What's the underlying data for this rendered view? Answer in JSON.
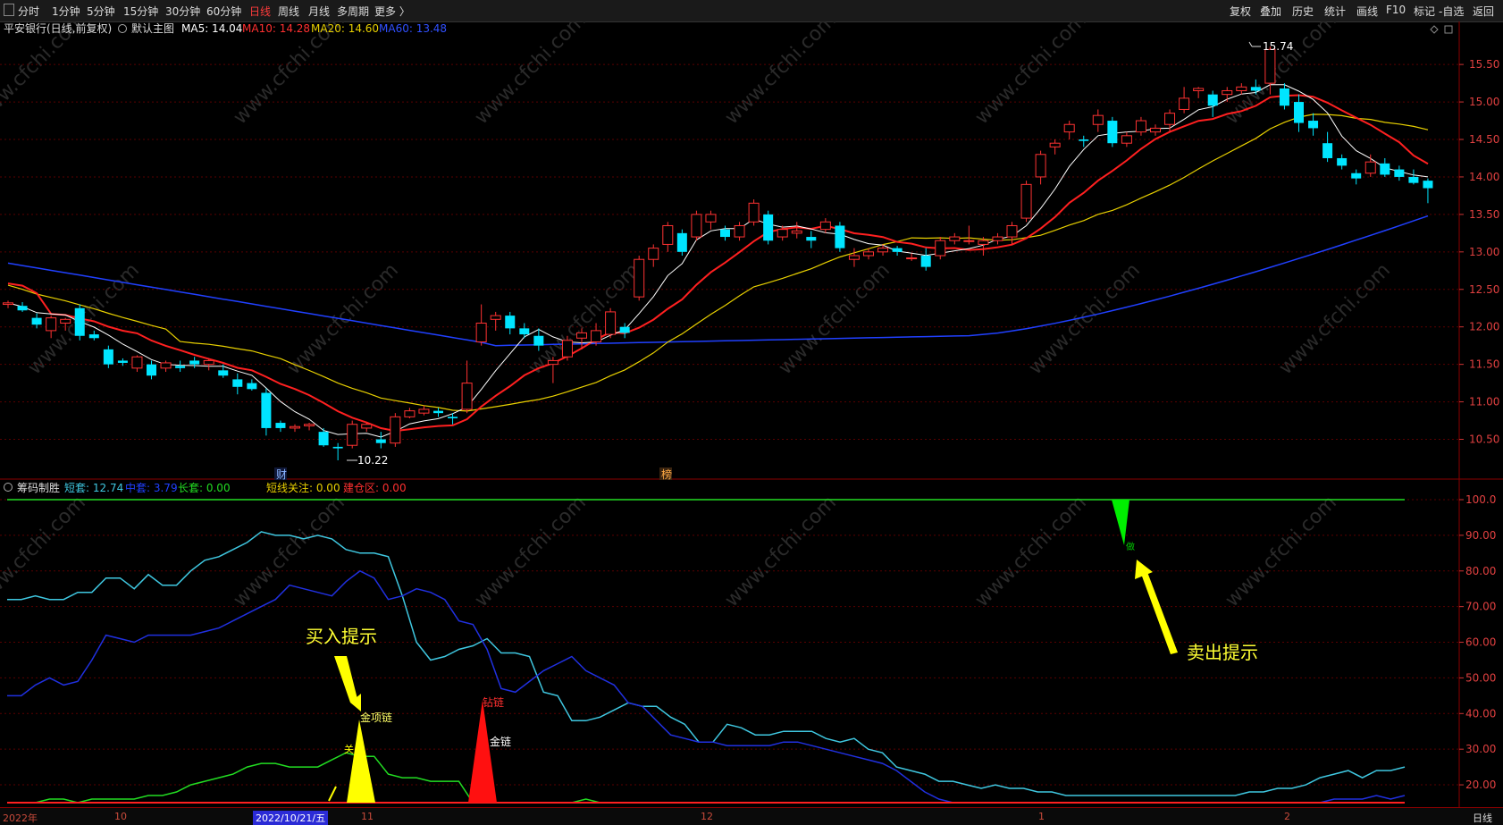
{
  "toolbar": {
    "left": [
      {
        "label": "分时"
      },
      {
        "label": "1分钟"
      },
      {
        "label": "5分钟"
      },
      {
        "label": "15分钟"
      },
      {
        "label": "30分钟"
      },
      {
        "label": "60分钟"
      },
      {
        "label": "日线",
        "active": true
      },
      {
        "label": "周线"
      },
      {
        "label": "月线"
      },
      {
        "label": "多周期"
      },
      {
        "label": "更多 〉"
      }
    ],
    "right": [
      {
        "label": "复权"
      },
      {
        "label": "叠加"
      },
      {
        "label": "历史"
      },
      {
        "label": "统计"
      },
      {
        "label": "画线"
      },
      {
        "label": "F10"
      },
      {
        "label": "标记"
      },
      {
        "label": "-自选"
      },
      {
        "label": "返回"
      }
    ]
  },
  "main_header": {
    "stock": "平安银行(日线,前复权)",
    "indicator": "默认主图",
    "ma5": "MA5: 14.04",
    "ma10": "MA10: 14.28",
    "ma20": "MA20: 14.60",
    "ma60": "MA60: 13.48"
  },
  "sub_header": {
    "name": "筹码制胜",
    "short": "短套: 12.74",
    "mid": "中套: 3.79",
    "long": "长套: 0.00",
    "focus": "短线关注: 0.00",
    "build": "建仓区: 0.00"
  },
  "price_axis": [
    "15.50",
    "15.00",
    "14.50",
    "14.00",
    "13.50",
    "13.00",
    "12.50",
    "12.00",
    "11.50",
    "11.00",
    "10.50"
  ],
  "sub_axis": [
    "100.0",
    "90.00",
    "80.00",
    "70.00",
    "60.00",
    "50.00",
    "40.00",
    "30.00",
    "20.00"
  ],
  "annotations": {
    "high": "15.74",
    "low": "10.22",
    "cai": "财",
    "bang": "榜",
    "buy_hint": "买入提示",
    "sell_hint": "卖出提示",
    "jinxianglian": "金项链",
    "zuanlian": "钻链",
    "jinlian": "金链",
    "guan": "关",
    "zuo": "做"
  },
  "date_axis": [
    {
      "label": "2022年"
    },
    {
      "label": "10"
    },
    {
      "label": "2022/10/21/五",
      "highlight": true
    },
    {
      "label": "11"
    },
    {
      "label": "12"
    },
    {
      "label": "1"
    },
    {
      "label": "2"
    }
  ],
  "period_label": "日线",
  "watermark": "www.cfchi.com",
  "colors": {
    "up": "#ff3232",
    "down": "#00e5ff",
    "ma5": "#ffffff",
    "ma10": "#ff2020",
    "ma20": "#e8d000",
    "ma60": "#2040ff",
    "short": "#3fc7e0",
    "mid": "#2030e0",
    "long": "#22dd22",
    "buy": "#ffff00",
    "sell": "#00ee00"
  },
  "chart_data": {
    "type": "candlestick",
    "candles": [
      [
        12.3,
        12.35,
        12.25,
        12.32
      ],
      [
        12.28,
        12.33,
        12.2,
        12.22
      ],
      [
        12.12,
        12.18,
        11.98,
        12.03
      ],
      [
        11.95,
        12.15,
        11.85,
        12.12
      ],
      [
        12.05,
        12.12,
        11.95,
        12.1
      ],
      [
        12.25,
        12.3,
        11.82,
        11.88
      ],
      [
        11.9,
        11.95,
        11.82,
        11.85
      ],
      [
        11.7,
        11.75,
        11.45,
        11.5
      ],
      [
        11.55,
        11.58,
        11.48,
        11.52
      ],
      [
        11.45,
        11.62,
        11.4,
        11.6
      ],
      [
        11.5,
        11.55,
        11.3,
        11.35
      ],
      [
        11.45,
        11.55,
        11.4,
        11.52
      ],
      [
        11.48,
        11.55,
        11.4,
        11.45
      ],
      [
        11.55,
        11.6,
        11.45,
        11.5
      ],
      [
        11.5,
        11.58,
        11.42,
        11.55
      ],
      [
        11.42,
        11.5,
        11.32,
        11.35
      ],
      [
        11.3,
        11.38,
        11.1,
        11.2
      ],
      [
        11.25,
        11.3,
        11.15,
        11.17
      ],
      [
        11.12,
        11.18,
        10.55,
        10.65
      ],
      [
        10.72,
        10.75,
        10.6,
        10.65
      ],
      [
        10.65,
        10.7,
        10.6,
        10.67
      ],
      [
        10.68,
        10.72,
        10.62,
        10.7
      ],
      [
        10.6,
        10.65,
        10.4,
        10.42
      ],
      [
        10.4,
        10.45,
        10.22,
        10.38
      ],
      [
        10.42,
        10.75,
        10.38,
        10.7
      ],
      [
        10.65,
        10.72,
        10.6,
        10.7
      ],
      [
        10.5,
        10.6,
        10.38,
        10.45
      ],
      [
        10.45,
        10.85,
        10.4,
        10.8
      ],
      [
        10.8,
        10.92,
        10.78,
        10.88
      ],
      [
        10.85,
        10.95,
        10.82,
        10.9
      ],
      [
        10.88,
        10.92,
        10.8,
        10.85
      ],
      [
        10.8,
        10.85,
        10.7,
        10.78
      ],
      [
        10.9,
        11.55,
        10.85,
        11.25
      ],
      [
        11.8,
        12.3,
        11.75,
        12.05
      ],
      [
        12.1,
        12.2,
        11.95,
        12.15
      ],
      [
        12.15,
        12.2,
        11.9,
        11.98
      ],
      [
        11.98,
        12.05,
        11.85,
        11.9
      ],
      [
        11.88,
        11.98,
        11.68,
        11.75
      ],
      [
        11.5,
        11.6,
        11.25,
        11.55
      ],
      [
        11.6,
        11.88,
        11.55,
        11.82
      ],
      [
        11.85,
        11.98,
        11.7,
        11.92
      ],
      [
        11.8,
        12.05,
        11.75,
        11.95
      ],
      [
        11.9,
        12.25,
        11.85,
        12.2
      ],
      [
        12.0,
        12.05,
        11.85,
        11.92
      ],
      [
        12.4,
        12.95,
        12.35,
        12.9
      ],
      [
        12.9,
        13.1,
        12.8,
        13.05
      ],
      [
        13.1,
        13.4,
        13.0,
        13.35
      ],
      [
        13.25,
        13.3,
        12.95,
        13.0
      ],
      [
        13.2,
        13.55,
        13.15,
        13.5
      ],
      [
        13.4,
        13.55,
        13.3,
        13.5
      ],
      [
        13.3,
        13.35,
        13.15,
        13.2
      ],
      [
        13.2,
        13.4,
        13.15,
        13.35
      ],
      [
        13.4,
        13.7,
        13.35,
        13.65
      ],
      [
        13.5,
        13.55,
        13.1,
        13.15
      ],
      [
        13.2,
        13.35,
        13.15,
        13.3
      ],
      [
        13.25,
        13.4,
        13.18,
        13.28
      ],
      [
        13.2,
        13.28,
        13.05,
        13.15
      ],
      [
        13.3,
        13.45,
        13.25,
        13.4
      ],
      [
        13.35,
        13.4,
        13.0,
        13.05
      ],
      [
        12.9,
        13.05,
        12.8,
        12.95
      ],
      [
        12.95,
        13.05,
        12.9,
        13.0
      ],
      [
        13.0,
        13.1,
        12.95,
        13.05
      ],
      [
        13.05,
        13.08,
        12.95,
        13.0
      ],
      [
        12.92,
        12.98,
        12.88,
        12.92
      ],
      [
        12.95,
        13.05,
        12.75,
        12.8
      ],
      [
        12.95,
        13.2,
        12.9,
        13.15
      ],
      [
        13.15,
        13.25,
        13.1,
        13.2
      ],
      [
        13.15,
        13.35,
        13.1,
        13.15
      ],
      [
        13.1,
        13.2,
        12.95,
        13.15
      ],
      [
        13.15,
        13.25,
        13.1,
        13.2
      ],
      [
        13.2,
        13.4,
        13.1,
        13.35
      ],
      [
        13.45,
        13.95,
        13.4,
        13.9
      ],
      [
        14.0,
        14.35,
        13.9,
        14.3
      ],
      [
        14.4,
        14.5,
        14.3,
        14.45
      ],
      [
        14.6,
        14.75,
        14.5,
        14.7
      ],
      [
        14.5,
        14.55,
        14.4,
        14.48
      ],
      [
        14.7,
        14.9,
        14.6,
        14.82
      ],
      [
        14.75,
        14.8,
        14.4,
        14.45
      ],
      [
        14.45,
        14.6,
        14.4,
        14.55
      ],
      [
        14.6,
        14.8,
        14.55,
        14.75
      ],
      [
        14.6,
        14.7,
        14.55,
        14.65
      ],
      [
        14.7,
        14.9,
        14.6,
        14.85
      ],
      [
        14.9,
        15.2,
        14.85,
        15.05
      ],
      [
        15.15,
        15.2,
        15.05,
        15.18
      ],
      [
        15.1,
        15.15,
        14.8,
        14.95
      ],
      [
        15.1,
        15.2,
        15.0,
        15.15
      ],
      [
        15.15,
        15.25,
        15.1,
        15.2
      ],
      [
        15.2,
        15.3,
        15.1,
        15.15
      ],
      [
        15.25,
        15.74,
        15.1,
        15.7
      ],
      [
        15.18,
        15.25,
        14.9,
        14.95
      ],
      [
        15.0,
        15.1,
        14.6,
        14.72
      ],
      [
        14.75,
        14.85,
        14.55,
        14.65
      ],
      [
        14.45,
        14.6,
        14.2,
        14.25
      ],
      [
        14.25,
        14.3,
        14.1,
        14.15
      ],
      [
        14.05,
        14.1,
        13.9,
        13.98
      ],
      [
        14.05,
        14.3,
        14.0,
        14.2
      ],
      [
        14.18,
        14.25,
        14.0,
        14.03
      ],
      [
        14.1,
        14.15,
        13.95,
        14.0
      ],
      [
        14.0,
        14.1,
        13.9,
        13.92
      ],
      [
        13.95,
        13.98,
        13.65,
        13.85
      ]
    ]
  }
}
